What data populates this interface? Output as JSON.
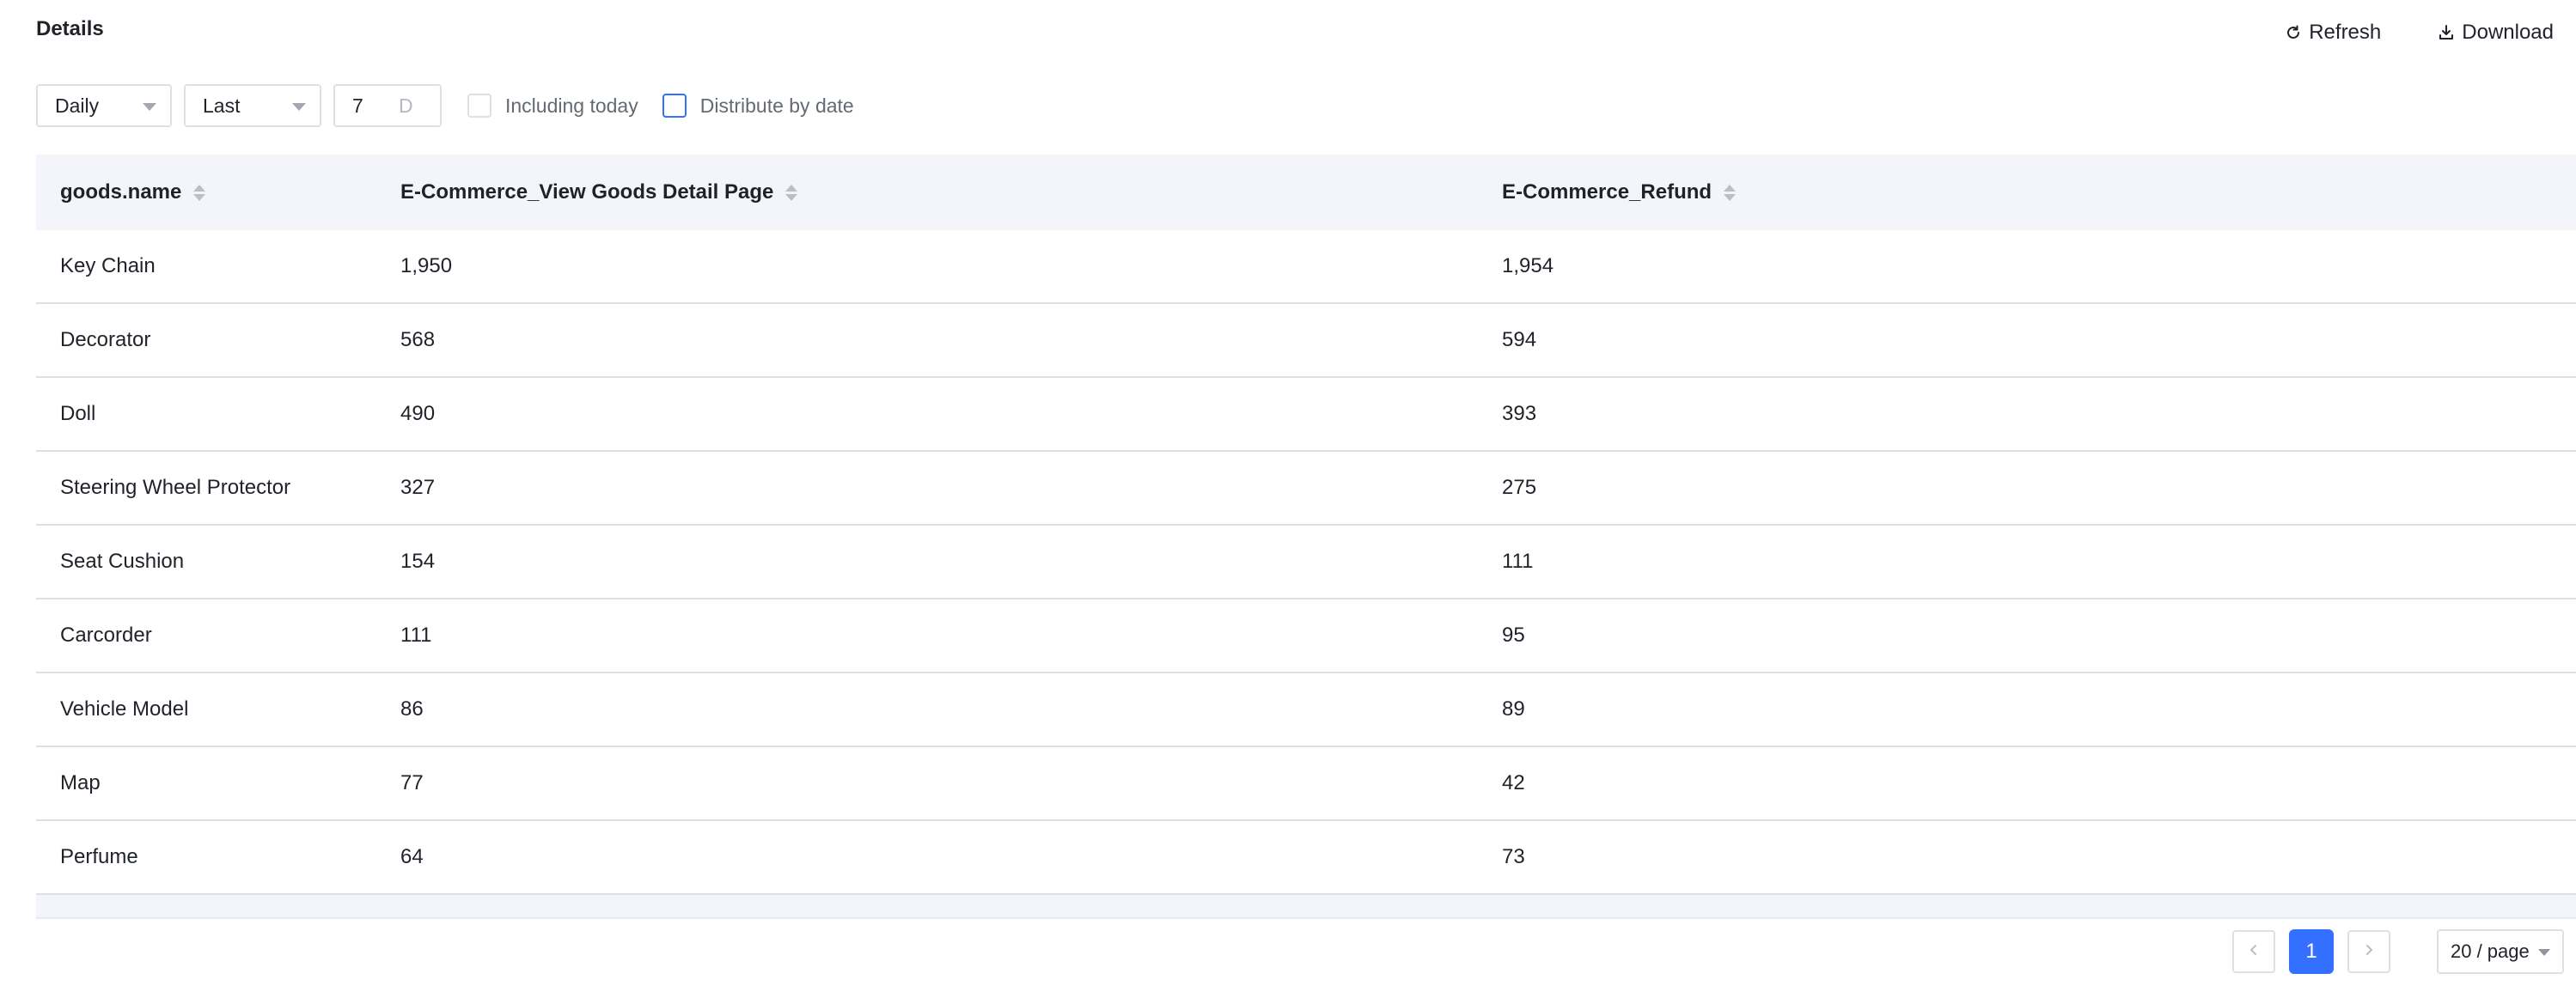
{
  "header": {
    "title": "Details",
    "refresh_label": "Refresh",
    "download_label": "Download"
  },
  "filters": {
    "granularity": "Daily",
    "range_mode": "Last",
    "range_value": "7",
    "range_unit": "D",
    "including_today_label": "Including today",
    "including_today_checked": false,
    "distribute_by_date_label": "Distribute by date",
    "distribute_by_date_checked": false
  },
  "table": {
    "columns": [
      "goods.name",
      "E-Commerce_View Goods Detail Page",
      "E-Commerce_Refund"
    ],
    "rows": [
      [
        "Key Chain",
        "1,950",
        "1,954"
      ],
      [
        "Decorator",
        "568",
        "594"
      ],
      [
        "Doll",
        "490",
        "393"
      ],
      [
        "Steering Wheel Protector",
        "327",
        "275"
      ],
      [
        "Seat Cushion",
        "154",
        "111"
      ],
      [
        "Carcorder",
        "111",
        "95"
      ],
      [
        "Vehicle Model",
        "86",
        "89"
      ],
      [
        "Map",
        "77",
        "42"
      ],
      [
        "Perfume",
        "64",
        "73"
      ]
    ]
  },
  "pagination": {
    "current_page": "1",
    "page_size": "20 / page"
  },
  "icons": {
    "refresh": "refresh-icon",
    "download": "download-icon",
    "sort": "sort-icon",
    "prev": "chevron-left-icon",
    "next": "chevron-right-icon",
    "dropdown": "chevron-down-icon"
  },
  "colors": {
    "accent": "#3370ff",
    "header_bg": "#f3f5fb",
    "border": "#dee0e3"
  }
}
